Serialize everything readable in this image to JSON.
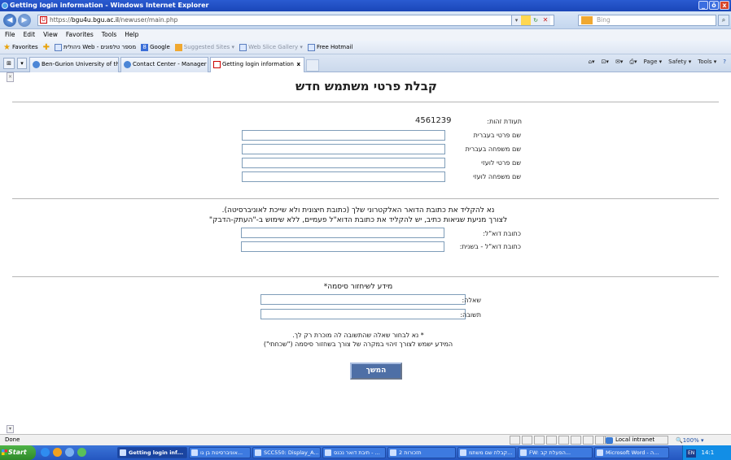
{
  "window": {
    "title": "Getting login information - Windows Internet Explorer",
    "buttons": {
      "minimize": "_",
      "maximize": "ō",
      "close": "x"
    }
  },
  "address": {
    "url_prefix": "https://",
    "url_host": "bgu4u.bgu.ac.il",
    "url_path": "/newuser/main.php",
    "search_placeholder": "Bing"
  },
  "menu": [
    "File",
    "Edit",
    "View",
    "Favorites",
    "Tools",
    "Help"
  ],
  "favorites": {
    "label": "Favorites",
    "items": [
      "ניהולית Web - מספר טלפונים",
      "Google",
      "Suggested Sites ▾",
      "Web Slice Gallery ▾",
      "Free Hotmail"
    ]
  },
  "tabs": [
    {
      "label": "Ben-Gurion University of the...",
      "active": false
    },
    {
      "label": "Contact Center - Manager - ...",
      "active": false
    },
    {
      "label": "Getting login information",
      "active": true
    }
  ],
  "commands": [
    "Page ▾",
    "Safety ▾",
    "Tools ▾"
  ],
  "page": {
    "heading": "קבלת פרטי משתמש חדש",
    "id_label": "תעודת זהות:",
    "id_value": "4561239",
    "first_name_he": "שם פרטי בעברית",
    "last_name_he": "שם משפחה בעברית",
    "first_name_en": "שם פרטי לועזי",
    "last_name_en": "שם משפחה לועזי",
    "email_note1": "נא להקליד את כתובת הדואר האלקטרוני שלך (כתובת חיצונית ולא שייכת לאוניברסיטה).",
    "email_note2": "לצורך מניעת שגיאות כתיב, יש להקליד את כתובת הדוא\"ל פעמיים, ללא שימוש ב-\"העתק-הדבק\"",
    "email_label": "כתובת דוא\"ל:",
    "email_again_label": "כתובת דוא\"ל - בשנית:",
    "recovery_title": "מידע לשיחזור סיסמה*",
    "question_label": "שאלה:",
    "answer_label": "תשובה:",
    "footnote1": "* נא לבחור שאלה שהתשובה לה מוכרת רק לך.",
    "footnote2": "המידע ישמש לצורך זיהוי במקרה של צורך בשחזור סיסמה (\"שכחתי\")",
    "continue_button": "המשך"
  },
  "status": {
    "left": "Done",
    "zone": "Local intranet",
    "zoom": "🔍100% ▾"
  },
  "taskbar": {
    "start": "Start",
    "items": [
      {
        "label": "Getting login inf...",
        "active": true
      },
      {
        "label": "אוניברסיטת בן גו...",
        "active": false
      },
      {
        "label": "SCC550: Display_A...",
        "active": false
      },
      {
        "label": "תיבת דואר נכנס - ...",
        "active": false
      },
      {
        "label": "2 תזכורות",
        "active": false
      },
      {
        "label": "קבלת שם משתמ...",
        "active": false
      },
      {
        "label": "FW: הפעלת קב...",
        "active": false
      },
      {
        "label": "Microsoft Word - ה...",
        "active": false
      }
    ],
    "lang": "EN",
    "clock": "14:1"
  }
}
